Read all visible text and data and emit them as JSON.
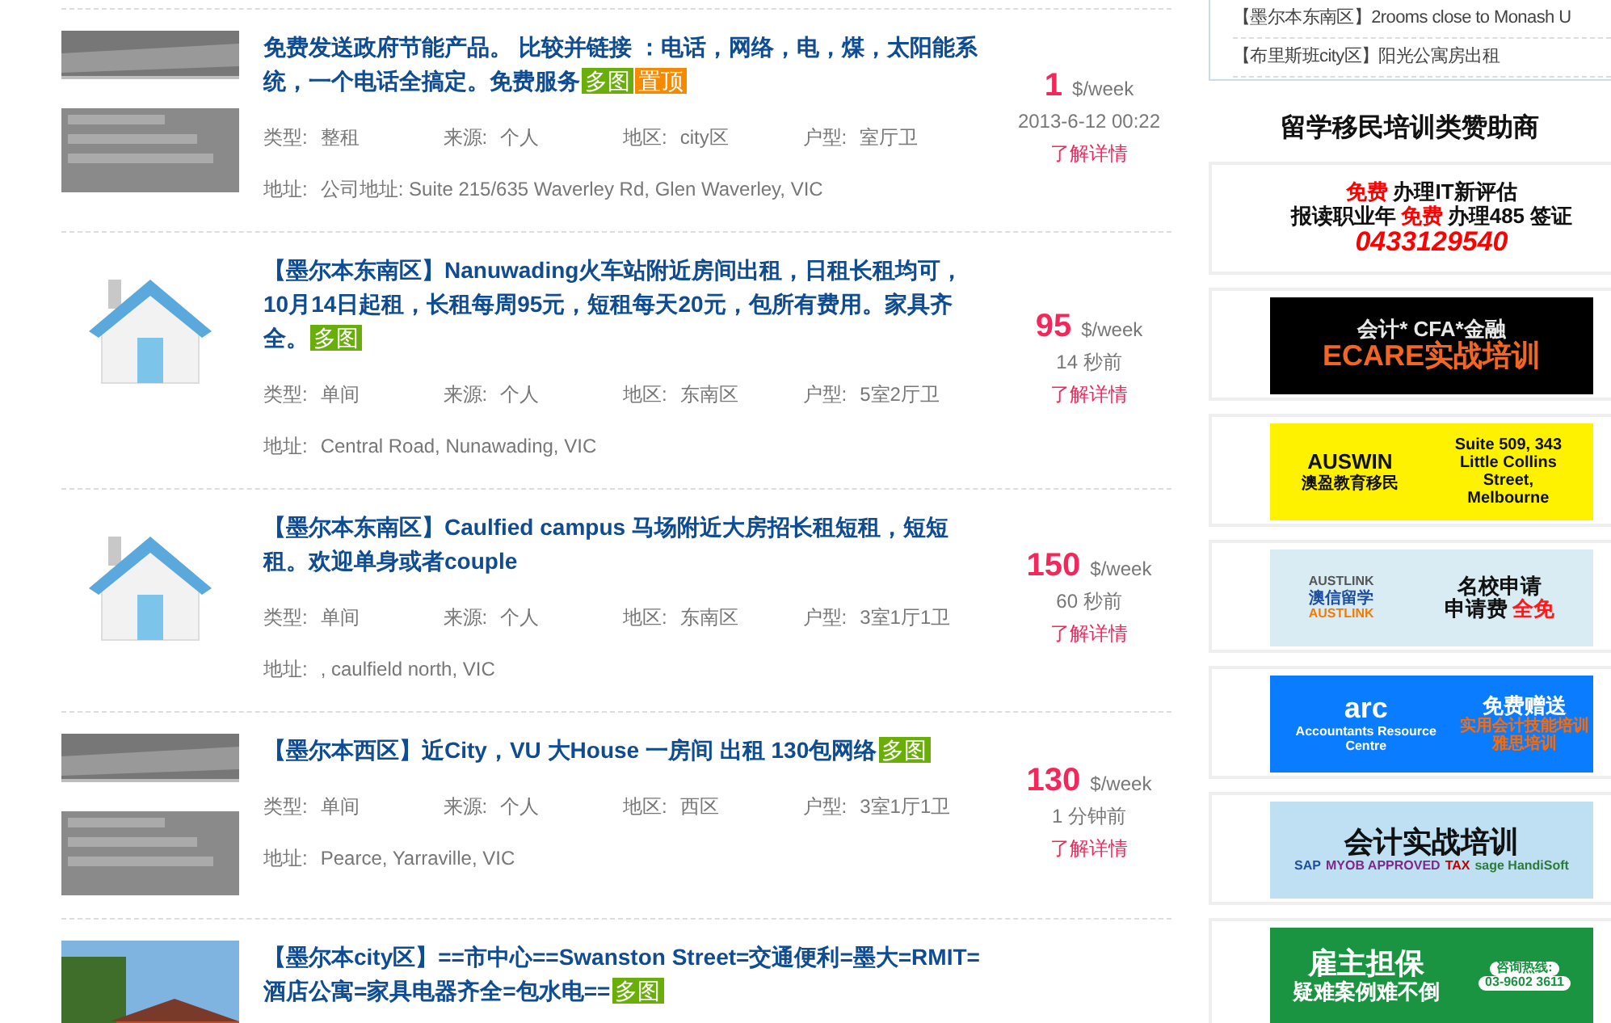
{
  "listings": [
    {
      "thumb": {
        "kind": "picture"
      },
      "title": "免费发送政府节能产品。 比较并链接 ：电话，网络，电，煤，太阳能系统，一个电话全搞定。免费服务",
      "tags": [
        {
          "text": "多图",
          "color": "#6aae0a"
        },
        {
          "text": "置顶",
          "color": "#f58a00"
        }
      ],
      "fields": [
        {
          "label": "类型:",
          "value": "整租"
        },
        {
          "label": "来源:",
          "value": "个人"
        },
        {
          "label": "地区:",
          "value": "city区"
        },
        {
          "label": "户型:",
          "value": "室厅卫"
        }
      ],
      "address": {
        "label": "地址:",
        "value": "公司地址:  Suite 215/635 Waverley Rd, Glen Waverley, VIC"
      },
      "price": "1",
      "unit": "$/week",
      "time": "2013-6-12 00:22",
      "link": "了解详情"
    },
    {
      "thumb": {
        "kind": "house"
      },
      "title": "【墨尔本东南区】Nanuwading火车站附近房间出租，日租长租均可，10月14日起租，长租每周95元，短租每天20元，包所有费用。家具齐全。",
      "tags": [
        {
          "text": "多图",
          "color": "#6aae0a"
        }
      ],
      "fields": [
        {
          "label": "类型:",
          "value": "单间"
        },
        {
          "label": "来源:",
          "value": "个人"
        },
        {
          "label": "地区:",
          "value": "东南区"
        },
        {
          "label": "户型:",
          "value": "5室2厅卫"
        }
      ],
      "address": {
        "label": "地址:",
        "value": "Central Road, Nunawading, VIC"
      },
      "price": "95",
      "unit": "$/week",
      "time": "14 秒前",
      "link": "了解详情"
    },
    {
      "thumb": {
        "kind": "house"
      },
      "title": "【墨尔本东南区】Caulfied campus 马场附近大房招长租短租，短短租。欢迎单身或者couple",
      "fields": [
        {
          "label": "类型:",
          "value": "单间"
        },
        {
          "label": "来源:",
          "value": "个人"
        },
        {
          "label": "地区:",
          "value": "东南区"
        },
        {
          "label": "户型:",
          "value": "3室1厅1卫"
        }
      ],
      "address": {
        "label": "地址:",
        "value": ", caulfield north, VIC"
      },
      "price": "150",
      "unit": "$/week",
      "time": "60 秒前",
      "link": "了解详情"
    },
    {
      "thumb": {
        "kind": "picture"
      },
      "title": "【墨尔本西区】近City，VU 大House 一房间 出租 130包网络",
      "tags": [
        {
          "text": "多图",
          "color": "#6aae0a"
        }
      ],
      "fields": [
        {
          "label": "类型:",
          "value": "单间"
        },
        {
          "label": "来源:",
          "value": "个人"
        },
        {
          "label": "地区:",
          "value": "西区"
        },
        {
          "label": "户型:",
          "value": "3室1厅1卫"
        }
      ],
      "address": {
        "label": "地址:",
        "value": "Pearce, Yarraville, VIC"
      },
      "price": "130",
      "unit": "$/week",
      "time": "1 分钟前",
      "link": "了解详情"
    },
    {
      "thumb": {
        "kind": "picture"
      },
      "title": "【墨尔本city区】==市中心==Swanston Street=交通便利=墨大=RMIT=酒店公寓=家具电器齐全=包水电==",
      "tags": [
        {
          "text": "多图",
          "color": "#6aae0a"
        }
      ]
    }
  ],
  "sidebar": {
    "recent": [
      "【墨尔本东南区】2rooms close to Monash U",
      "【布里斯班city区】阳光公寓房出租"
    ],
    "heading": "留学移民培训类赞助商",
    "banners": [
      {
        "color": "#ffffff",
        "columns": [
          [
            {
              "kind": "headline",
              "parts": [
                {
                  "text": "免费",
                  "color": "#ff0000"
                },
                {
                  "text": "办理IT新评估",
                  "color": "#111111"
                }
              ]
            },
            {
              "kind": "headline",
              "parts": [
                {
                  "text": "报读职业年",
                  "color": "#111111"
                },
                {
                  "text": "免费",
                  "color": "#ff0000"
                },
                {
                  "text": "办理485 签证",
                  "color": "#111111"
                }
              ]
            },
            {
              "kind": "phone",
              "parts": [
                {
                  "text": "0433129540",
                  "color": "#ff0000"
                }
              ]
            }
          ]
        ]
      },
      {
        "color": "#000000",
        "columns": [
          [
            {
              "kind": "headline",
              "parts": [
                {
                  "text": "会计* CFA*金融",
                  "color": "#e8e8e8"
                }
              ]
            },
            {
              "kind": "big",
              "parts": [
                {
                  "text": "ECARE实战培训",
                  "color": "#f26522"
                }
              ]
            }
          ]
        ]
      },
      {
        "color": "#fff200",
        "columns": [
          [
            {
              "kind": "headline",
              "parts": [
                {
                  "text": "AUSWIN",
                  "color": "#111111"
                }
              ]
            },
            {
              "kind": "text",
              "parts": [
                {
                  "text": "澳盈教育移民",
                  "color": "#111111"
                }
              ]
            }
          ],
          [
            {
              "kind": "text",
              "parts": [
                {
                  "text": "Suite 509, 343",
                  "color": "#111111"
                }
              ]
            },
            {
              "kind": "text",
              "parts": [
                {
                  "text": "Little  Collins",
                  "color": "#111111"
                }
              ]
            },
            {
              "kind": "text",
              "parts": [
                {
                  "text": "Street,",
                  "color": "#111111"
                }
              ]
            },
            {
              "kind": "text",
              "parts": [
                {
                  "text": "Melbourne",
                  "color": "#111111"
                }
              ]
            }
          ]
        ]
      },
      {
        "color": "#d9ecf4",
        "columns": [
          [
            {
              "kind": "caption",
              "parts": [
                {
                  "text": "AUSTLINK",
                  "color": "#555555"
                }
              ]
            },
            {
              "kind": "text",
              "parts": [
                {
                  "text": "澳信留学",
                  "color": "#1f4fa0"
                }
              ]
            },
            {
              "kind": "caption",
              "parts": [
                {
                  "text": "AUSTLINK",
                  "color": "#f57a00"
                }
              ]
            }
          ],
          [
            {
              "kind": "headline",
              "parts": [
                {
                  "text": "名校申请",
                  "color": "#111111"
                }
              ]
            },
            {
              "kind": "headline",
              "parts": [
                {
                  "text": "申请费",
                  "color": "#111111"
                },
                {
                  "text": "全免",
                  "color": "#ff1a1a"
                }
              ]
            }
          ]
        ]
      },
      {
        "color": "#0a7cff",
        "columns": [
          [
            {
              "kind": "big",
              "parts": [
                {
                  "text": "arc",
                  "color": "#ffffff"
                }
              ]
            },
            {
              "kind": "caption",
              "parts": [
                {
                  "text": "Accountants Resource Centre",
                  "color": "#ffffff"
                }
              ]
            }
          ],
          [
            {
              "kind": "headline",
              "parts": [
                {
                  "text": "免费赠送",
                  "color": "#ffffff"
                }
              ]
            },
            {
              "kind": "text",
              "parts": [
                {
                  "text": "实用会计技能培训",
                  "color": "#ff6a00"
                }
              ]
            },
            {
              "kind": "text",
              "parts": [
                {
                  "text": "雅思培训",
                  "color": "#ff6a00"
                }
              ]
            }
          ]
        ]
      },
      {
        "color": "#bfe0f2",
        "columns": [
          [
            {
              "kind": "big",
              "parts": [
                {
                  "text": "会计实战培训",
                  "color": "#111111"
                }
              ]
            },
            {
              "kind": "caption",
              "parts": [
                {
                  "text": "SAP",
                  "color": "#1f4fa0"
                },
                {
                  "text": "MYOB APPROVED",
                  "color": "#7a2a8a"
                },
                {
                  "text": "TAX",
                  "color": "#c00000"
                },
                {
                  "text": "sage HandiSoft",
                  "color": "#2a7a3a"
                }
              ]
            }
          ]
        ]
      },
      {
        "color": "#1a9440",
        "columns": [
          [
            {
              "kind": "big",
              "parts": [
                {
                  "text": "雇主担保",
                  "color": "#ffffff"
                }
              ]
            },
            {
              "kind": "headline",
              "parts": [
                {
                  "text": "疑难案例难不倒",
                  "color": "#ffffff"
                }
              ]
            }
          ],
          [
            {
              "kind": "caption",
              "parts": [
                {
                  "text": "咨询热线:",
                  "color": "#1a9440"
                }
              ]
            },
            {
              "kind": "caption",
              "parts": [
                {
                  "text": "03-9602 3611",
                  "color": "#1a9440"
                }
              ]
            }
          ]
        ]
      }
    ]
  }
}
